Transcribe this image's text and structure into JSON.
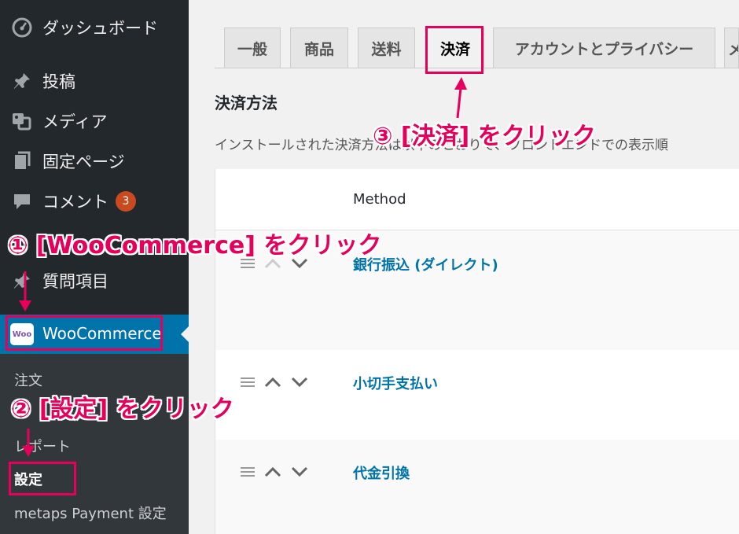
{
  "sidebar": {
    "items": [
      {
        "label": "ダッシュボード",
        "icon": "dashboard-icon"
      },
      {
        "label": "投稿",
        "icon": "pushpin-icon"
      },
      {
        "label": "メディア",
        "icon": "media-icon"
      },
      {
        "label": "固定ページ",
        "icon": "page-icon"
      },
      {
        "label": "コメント",
        "icon": "comment-icon",
        "badge": "3"
      },
      {
        "label": "質問項目",
        "icon": "pushpin-icon"
      }
    ],
    "woocommerce": {
      "label": "WooCommerce",
      "logo": "Woo"
    },
    "submenu": [
      {
        "label": "注文"
      },
      {
        "label": "レポート"
      },
      {
        "label": "設定",
        "current": true
      },
      {
        "label": "metaps Payment 設定"
      }
    ]
  },
  "main": {
    "tabs": [
      {
        "label": "一般"
      },
      {
        "label": "商品"
      },
      {
        "label": "送料"
      },
      {
        "label": "決済",
        "active": true
      },
      {
        "label": "アカウントとプライバシー"
      },
      {
        "label": "メ"
      }
    ],
    "section_title": "決済方法",
    "section_desc": "インストールされた決済方法は以下のとおりで、フロントエンドでの表示順",
    "table": {
      "column_method": "Method",
      "rows": [
        {
          "name": "銀行振込 (ダイレクト)"
        },
        {
          "name": "小切手支払い"
        },
        {
          "name": "代金引換"
        }
      ]
    }
  },
  "annotations": {
    "step1": "① [WooCommerce] をクリック",
    "step2": "② [設定] をクリック",
    "step3": "③ [決済] をクリック"
  },
  "colors": {
    "sidebar_bg": "#23282d",
    "submenu_bg": "#32373c",
    "active_menu": "#0073aa",
    "link": "#0073aa",
    "annotation": "#e6005c",
    "badge": "#ca4a1f"
  }
}
